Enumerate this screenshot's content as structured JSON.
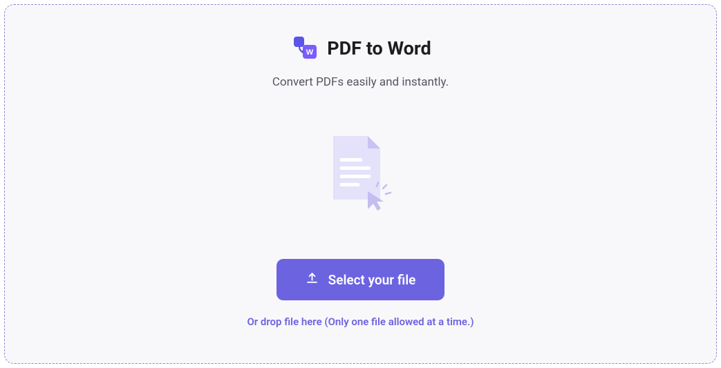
{
  "header": {
    "title": "PDF to Word",
    "subtitle": "Convert PDFs easily and instantly.",
    "logo_badge_letter": "W"
  },
  "actions": {
    "select_button_label": "Select your file",
    "drop_hint": "Or drop file here (Only one file allowed at a time.)"
  },
  "colors": {
    "primary": "#6c63e0",
    "border": "#8b87d6",
    "panel_bg": "#f8f8fa"
  }
}
